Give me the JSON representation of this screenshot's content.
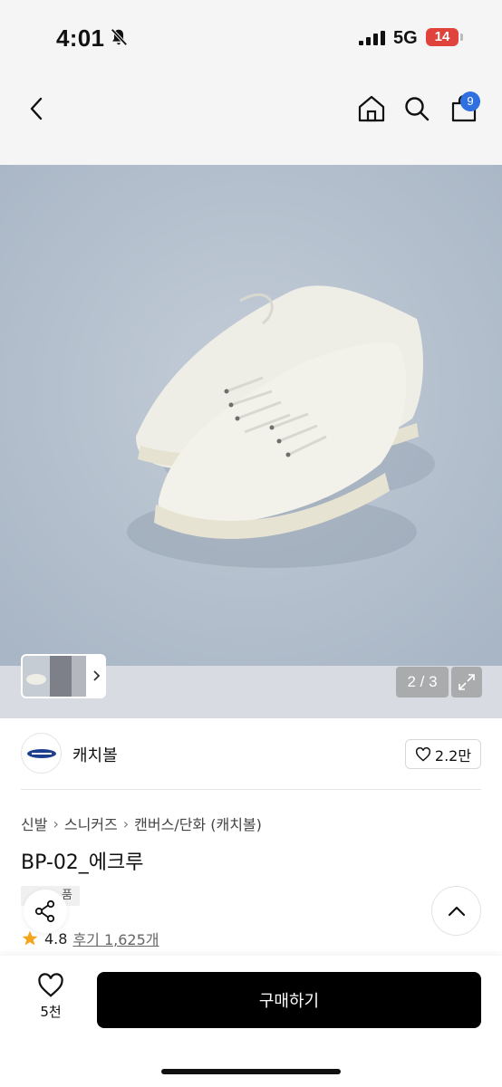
{
  "status_bar": {
    "time": "4:01",
    "network": "5G",
    "battery": "14"
  },
  "header": {
    "cart_count": "9"
  },
  "gallery": {
    "counter": "2 / 3"
  },
  "brand": {
    "name": "캐치볼",
    "likes": "2.2만"
  },
  "breadcrumb": [
    "신발",
    "스니커즈",
    "캔버스/단화 (캐치볼)"
  ],
  "product": {
    "title": "BP-02_에크루",
    "tag": "품",
    "rating": "4.8",
    "reviews": "후기 1,625개"
  },
  "bottom": {
    "wish_count": "5천",
    "buy_label": "구매하기"
  },
  "colors": {
    "accent_blue": "#2f6fe0",
    "battery_red": "#e0433c",
    "star": "#f4a51c"
  }
}
